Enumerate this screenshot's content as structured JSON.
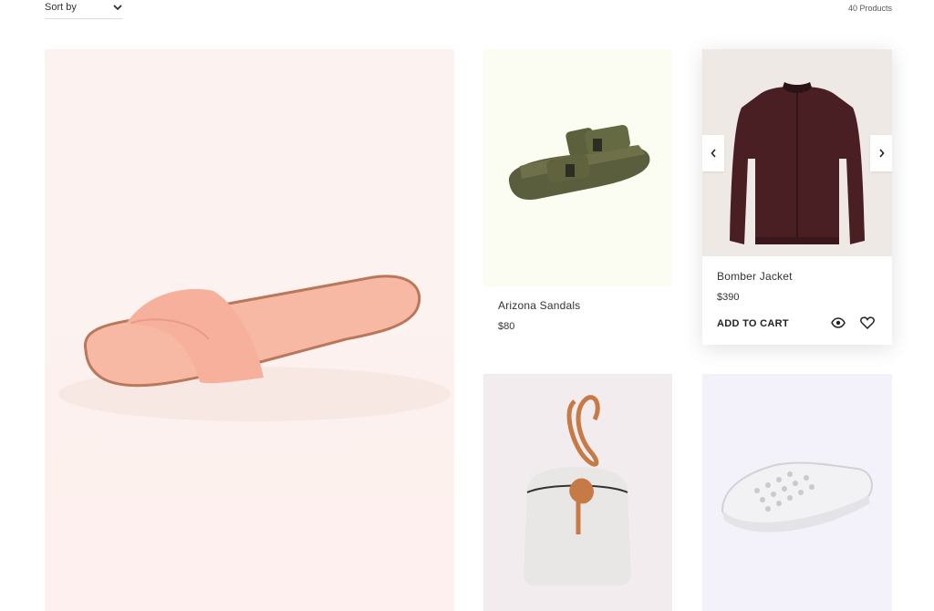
{
  "toolbar": {
    "sort_label": "Sort by",
    "product_count": "40 Products"
  },
  "products": [
    {
      "name": "Arizona Sandals",
      "price": "$80"
    },
    {
      "name": "Bomber Jacket",
      "price": "$390",
      "add_to_cart": "ADD TO CART"
    }
  ],
  "icons": {
    "sort": "chevron-down-icon",
    "prev": "chevron-left-icon",
    "next": "chevron-right-icon",
    "quick_view": "eye-icon",
    "wishlist": "heart-icon"
  },
  "colors": {
    "hero_bg": "#fcf3f0",
    "sandals_bg": "#fbfdf2",
    "jacket_bg": "#efe9e6",
    "bag_bg": "#f3ecee",
    "sneaker_bg": "#f3f2fb"
  }
}
